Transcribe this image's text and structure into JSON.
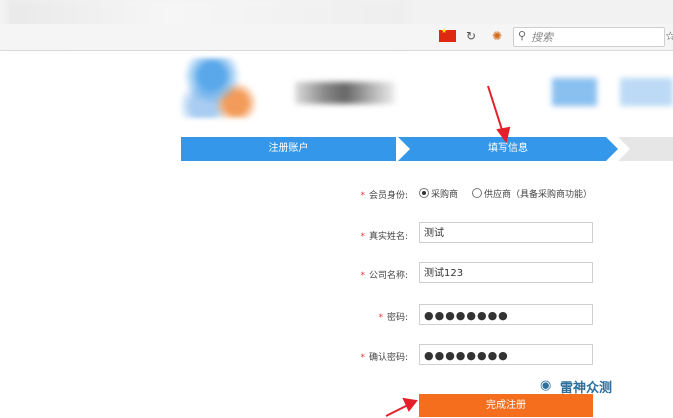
{
  "browser": {
    "search_placeholder": "搜索",
    "search_icon": "magnifier-icon",
    "reload_icon": "↻",
    "star_icon": "☆"
  },
  "steps": [
    {
      "label": "注册账户"
    },
    {
      "label": "填写信息"
    }
  ],
  "form": {
    "identity": {
      "label": "会员身份:",
      "options": [
        {
          "label": "采购商",
          "checked": true
        },
        {
          "label": "供应商（具备采购商功能）",
          "checked": false
        }
      ]
    },
    "real_name": {
      "label": "真实姓名:",
      "value": "测试"
    },
    "company": {
      "label": "公司名称:",
      "value": "测试123"
    },
    "password": {
      "label": "密码:",
      "value": "●●●●●●●●"
    },
    "confirm_password": {
      "label": "确认密码:",
      "value": "●●●●●●●●"
    },
    "submit_label": "完成注册",
    "required_mark": "*"
  },
  "watermark": {
    "text": "雷神众测"
  },
  "colors": {
    "accent": "#3597ea",
    "submit": "#f56e1e",
    "annotation_arrow": "#e4202a"
  }
}
